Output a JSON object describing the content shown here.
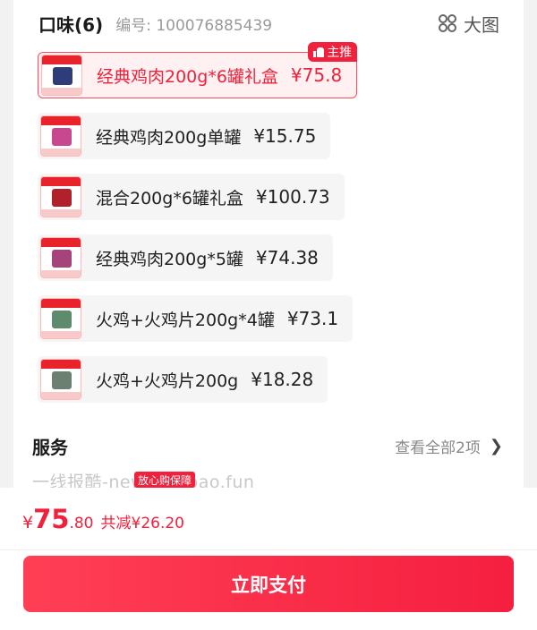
{
  "header": {
    "title": "口味(6)",
    "code_text": "编号: 100076885439",
    "bigview_label": "大图"
  },
  "options": [
    {
      "label": "经典鸡肉200g*6罐礼盒",
      "price": "¥75.8",
      "selected": true,
      "tag": "主推",
      "can_color": "#2f3c7a"
    },
    {
      "label": "经典鸡肉200g单罐",
      "price": "¥15.75",
      "selected": false,
      "can_color": "#c8488f"
    },
    {
      "label": "混合200g*6罐礼盒",
      "price": "¥100.73",
      "selected": false,
      "can_color": "#b0212c"
    },
    {
      "label": "经典鸡肉200g*5罐",
      "price": "¥74.38",
      "selected": false,
      "can_color": "#a6437b"
    },
    {
      "label": "火鸡+火鸡片200g*4罐",
      "price": "¥73.1",
      "selected": false,
      "can_color": "#5f8a6e"
    },
    {
      "label": "火鸡+火鸡片200g",
      "price": "¥18.28",
      "selected": false,
      "can_color": "#6b8070"
    }
  ],
  "service": {
    "title": "服务",
    "more_label": "查看全部2项"
  },
  "watermark": "一线报酷-new.xianbao.fun",
  "promo_chip": "放心购保障",
  "footer": {
    "currency": "¥",
    "price_int": "75",
    "price_dec": ".80",
    "saving": "共减¥26.20",
    "pay_label": "立即支付"
  },
  "colors": {
    "accent": "#f0213c",
    "selected_bg": "#fff1f1"
  }
}
